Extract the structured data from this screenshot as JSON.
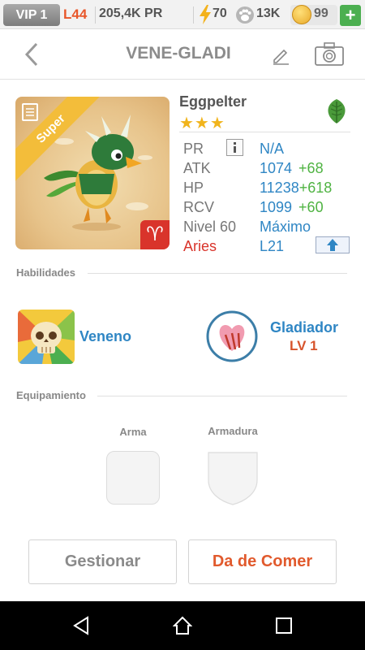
{
  "status_bar": {
    "vip": "VIP 1",
    "level": "L44",
    "pr": "205,4K PR",
    "energy": "70",
    "food": "13K",
    "gems": "99",
    "plus": "+"
  },
  "header": {
    "title": "VENE-GLADI"
  },
  "pet": {
    "ribbon": "Super",
    "name": "Eggpelter",
    "stars": "★★★",
    "element_icon": "leaf-icon",
    "stats": [
      {
        "label": "PR",
        "value": "N/A",
        "bonus": ""
      },
      {
        "label": "ATK",
        "value": "1074",
        "bonus": "+68"
      },
      {
        "label": "HP",
        "value": "11238",
        "bonus": "+618"
      },
      {
        "label": "RCV",
        "value": "1099",
        "bonus": "+60"
      },
      {
        "label": "Nivel 60",
        "value": "Máximo",
        "bonus": ""
      },
      {
        "label": "Aries",
        "value": "L21",
        "bonus": ""
      }
    ]
  },
  "sections": {
    "abilities": "Habilidades",
    "equipment": "Equipamiento"
  },
  "abilities": [
    {
      "name": "Veneno",
      "icon": "skull-icon"
    },
    {
      "name": "Gladiador",
      "level": "LV 1",
      "icon": "heart-claw-icon"
    }
  ],
  "equipment": {
    "weapon": "Arma",
    "armor": "Armadura"
  },
  "buttons": {
    "manage": "Gestionar",
    "feed": "Da de Comer"
  },
  "colors": {
    "accent_blue": "#2f86c4",
    "bonus_green": "#4fb342",
    "feed_orange": "#e15a2d",
    "aries_red": "#d9342b",
    "star_yellow": "#f1b41c"
  }
}
